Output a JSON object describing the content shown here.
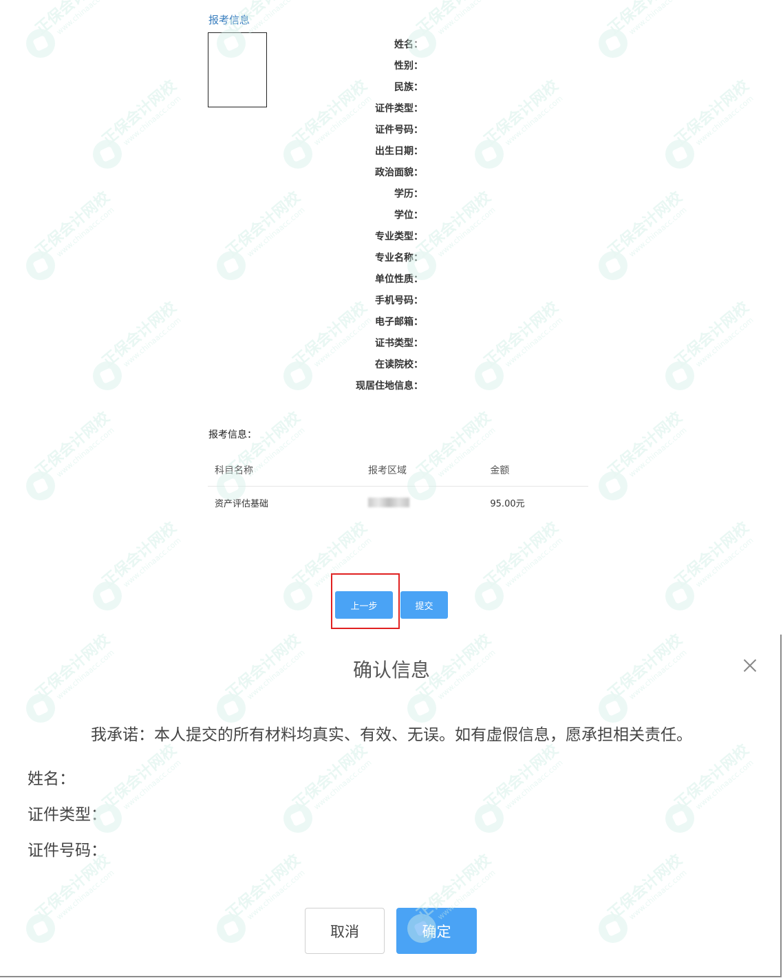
{
  "form": {
    "section_title": "报考信息",
    "fields": [
      "姓名：",
      "性别：",
      "民族：",
      "证件类型：",
      "证件号码：",
      "出生日期：",
      "政治面貌：",
      "学历：",
      "学位：",
      "专业类型：",
      "专业名称：",
      "单位性质：",
      "手机号码：",
      "电子邮箱：",
      "证书类型：",
      "在读院校：",
      "现居住地信息："
    ]
  },
  "registration": {
    "label": "报考信息：",
    "columns": [
      "科目名称",
      "报考区域",
      "金额"
    ],
    "rows": [
      {
        "subject": "资产评估基础",
        "region": "",
        "amount": "95.00元"
      }
    ]
  },
  "buttons": {
    "prev": "上一步",
    "submit": "提交"
  },
  "dialog": {
    "title": "确认信息",
    "pledge": "我承诺：本人提交的所有材料均真实、有效、无误。如有虚假信息，愿承担相关责任。",
    "fields": [
      "姓名：",
      "证件类型：",
      "证件号码："
    ],
    "cancel_label": "取消",
    "ok_label": "确定"
  },
  "watermark": {
    "title": "正保会计网校",
    "url": "www.chinaacc.com"
  },
  "colors": {
    "primary_button": "#4aa3f5",
    "link_blue": "#3a7fbf",
    "highlight_red": "#e02020"
  }
}
